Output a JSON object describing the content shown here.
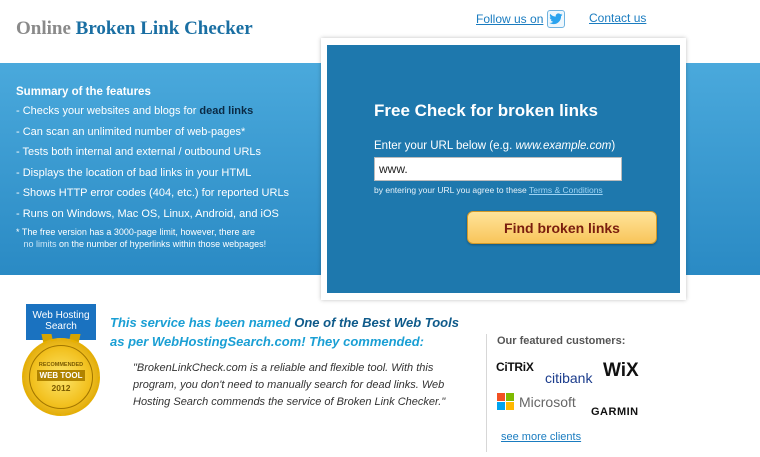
{
  "header": {
    "title_part1": "Online",
    "title_part2": "Broken Link Checker",
    "follow_label": "Follow us on",
    "contact_label": "Contact us"
  },
  "features": {
    "heading": "Summary of the features",
    "items": [
      {
        "text": "- Checks your websites and blogs for ",
        "bold": "dead links"
      },
      {
        "text": "- Can scan an unlimited number of web-pages*"
      },
      {
        "text": "- Tests both internal and external / outbound URLs"
      },
      {
        "text": "- Displays the location of bad links in your HTML"
      },
      {
        "text": "- Shows HTTP error codes (404, etc.) for reported URLs"
      },
      {
        "text": "- Runs on Windows, Mac OS, Linux, Android, and iOS"
      }
    ],
    "note_line1": "*  The free version has a 3000-page limit, however, there are",
    "note_hl": "no limits",
    "note_line2": " on the number of hyperlinks within those webpages!"
  },
  "check": {
    "heading": "Free Check for broken links",
    "prompt": "Enter your URL below (e.g. ",
    "prompt_example": "www.example.com",
    "prompt_end": ")",
    "url_value": "www.",
    "agree_text": "by entering your URL you agree to these ",
    "terms_label": "Terms & Conditions",
    "button_label": "Find broken links"
  },
  "award": {
    "badge_line1": "Web Hosting",
    "badge_line2": "Search",
    "recommended": "RECOMMENDED",
    "web_tool": "WEB TOOL",
    "year": "2012"
  },
  "named": {
    "part1": "This service has been named ",
    "part2": "One of the Best Web Tools",
    "part3": " as per WebHostingSearch.com! They commended:",
    "quote": "\"BrokenLinkCheck.com is a reliable and flexible tool. With this program, you don't need to manually search for dead links. Web Hosting Search commends the service of Broken Link Checker.\""
  },
  "customers": {
    "heading": "Our featured customers:",
    "citrix": "CiTRiX",
    "citibank": "citibank",
    "wix": "WiX",
    "microsoft": "Microsoft",
    "garmin": "GARMIN",
    "see_more": "see more clients"
  },
  "colors": {
    "band": "#3a9bd3",
    "box": "#1e78ad",
    "button": "#f8c55a",
    "link": "#1a7cc0"
  }
}
